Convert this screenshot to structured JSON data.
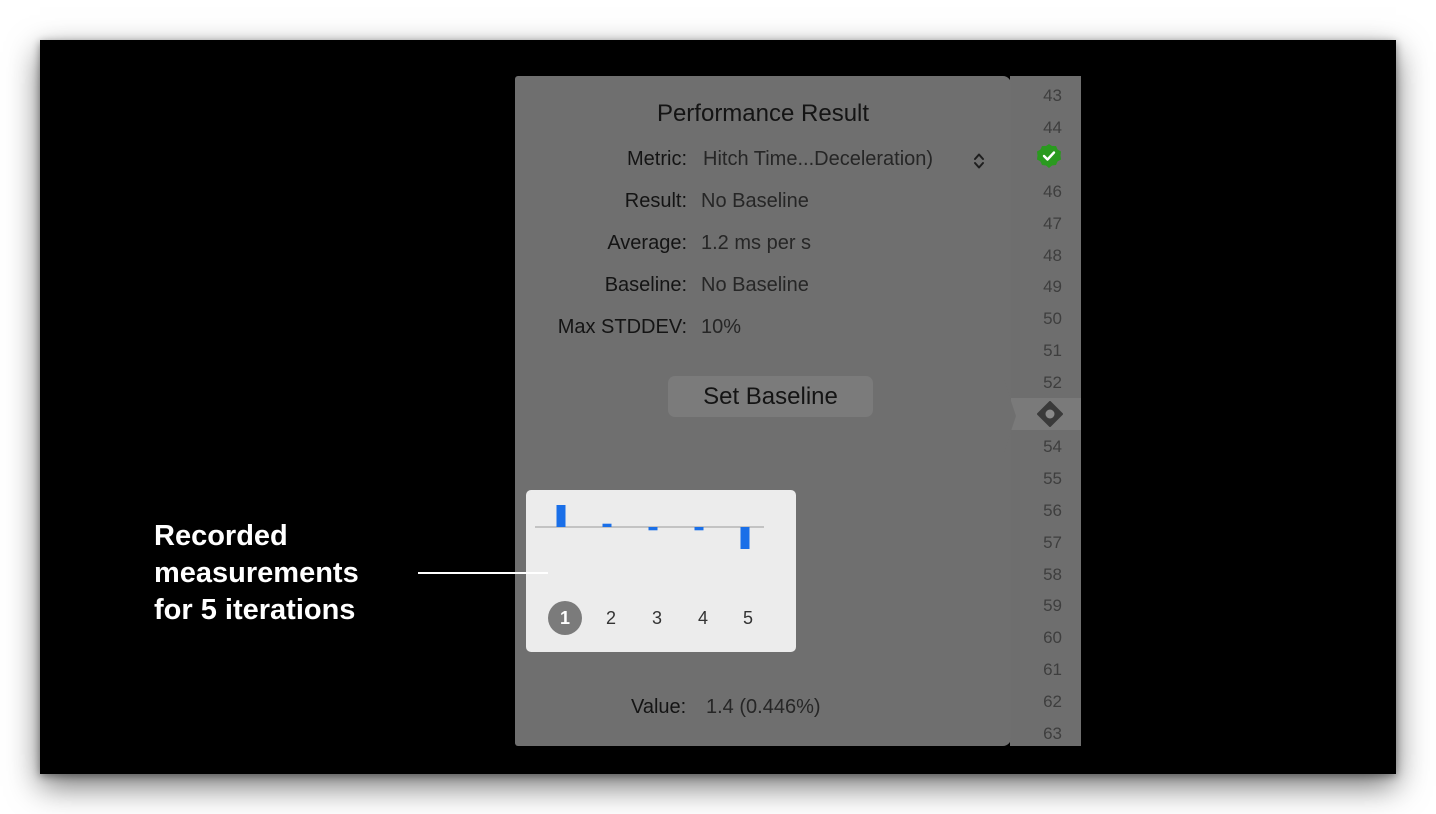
{
  "panel": {
    "title": "Performance Result",
    "rows": [
      {
        "label": "Metric:",
        "value": "Hitch Time...Deceleration)"
      },
      {
        "label": "Result:",
        "value": "No Baseline"
      },
      {
        "label": "Average:",
        "value": "1.2 ms per s"
      },
      {
        "label": "Baseline:",
        "value": "No Baseline"
      },
      {
        "label": "Max STDDEV:",
        "value": "10%"
      }
    ],
    "set_baseline_label": "Set Baseline",
    "value_label": "Value:",
    "value_text": "1.4 (0.446%)"
  },
  "iterations": {
    "labels": [
      "1",
      "2",
      "3",
      "4",
      "5"
    ],
    "selected": "1",
    "bar_color": "#1a6fe8"
  },
  "chart_data": {
    "type": "bar",
    "categories": [
      "1",
      "2",
      "3",
      "4",
      "5"
    ],
    "values": [
      1.0,
      0.15,
      -0.15,
      -0.15,
      -1.0
    ]
  },
  "gutter": {
    "lines": [
      "43",
      "44",
      "",
      "46",
      "47",
      "48",
      "49",
      "50",
      "51",
      "52",
      "",
      "54",
      "55",
      "56",
      "57",
      "58",
      "59",
      "60",
      "61",
      "62",
      "63"
    ],
    "pass_icon": "checkmark-circle-icon",
    "run_icon": "diamond-icon",
    "pass_color": "#2a9a1f"
  },
  "annotation": {
    "line1": "Recorded",
    "line2": "measurements",
    "line3": "for 5 iterations"
  }
}
